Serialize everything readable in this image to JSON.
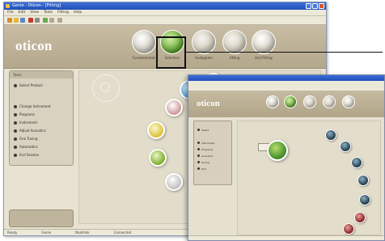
{
  "main_window": {
    "title": "Genie - Oticon - [Fitting]",
    "menu": [
      "File",
      "Edit",
      "View",
      "Tools",
      "Fitting",
      "Help"
    ],
    "logo": "oticon",
    "steps": [
      {
        "label": "Fundamentals",
        "color": "#d9d6cc"
      },
      {
        "label": "Selection",
        "color": "#7bbf3a"
      },
      {
        "label": "Audiogram",
        "color": "#d7d2c3"
      },
      {
        "label": "Fitting",
        "color": "#d7d2c3"
      },
      {
        "label": "End Fitting",
        "color": "#e6e3da"
      }
    ],
    "sidebar_title": "Tasks",
    "sidebar_items": [
      "Select Product",
      "Change Instrument",
      "Programs",
      "Instrument",
      "Adjust Acoustics",
      "Fine Tuning",
      "Automatics",
      "End Session"
    ],
    "status": [
      "Ready",
      "Genie",
      "Noahlink",
      "Connected"
    ]
  },
  "front_window": {
    "logo": "oticon",
    "steps_colors": [
      "#d6d2c5",
      "#7bbf3a",
      "#d6d2c5",
      "#d6d2c5",
      "#e3e0d6"
    ],
    "sidebar_items": [
      "Select",
      "Instrument",
      "Programs",
      "Acoustics",
      "Tuning",
      "End"
    ]
  },
  "colors": {
    "titlebar": "#2a5ccc",
    "header": "#bdb196",
    "panel": "#e2dccb",
    "highlight_box": "#111111"
  }
}
